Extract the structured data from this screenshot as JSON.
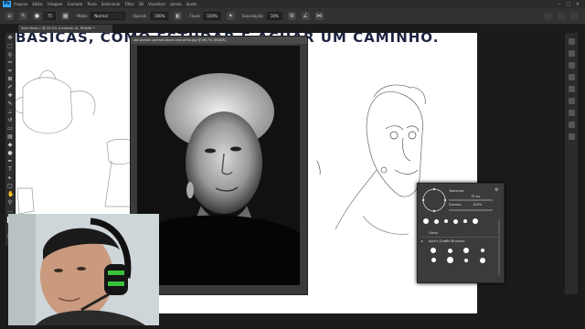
{
  "menubar": {
    "items": [
      "Arquivo",
      "Editar",
      "Imagem",
      "Camada",
      "Texto",
      "Selecionar",
      "Filtro",
      "3D",
      "Visualizar",
      "Janela",
      "Ajuda"
    ],
    "controls": [
      "–",
      "□",
      "✕"
    ]
  },
  "options": {
    "size_value": "75",
    "mode_label": "Modo:",
    "mode_value": "Normal",
    "opacity_label": "Opacid.:",
    "opacity_value": "100%",
    "flow_label": "Fluxo:",
    "flow_value": "100%",
    "smooth_label": "Suavização:",
    "smooth_value": "10%"
  },
  "document": {
    "tab_label": "Sem título-1 @ 33,3% (Camada 14, RGB/8) *",
    "canvas_title": "BÁSICAS, COMO ESTUDAR E ACHAR UM CAMINHO."
  },
  "photo_window": {
    "title": "old-woman-portrait-black-and-white.jpg @ 66,7% (RGB/8)",
    "status": "66,67%"
  },
  "brush_panel": {
    "size_label": "Tamanho:",
    "size_value": "75 px",
    "hardness_label": "Dureza:",
    "hardness_value": "100%",
    "folder_label": "Kyle's Graffiti Brushes",
    "section_label": "Geral"
  },
  "colors": {
    "accent": "#31a8ff",
    "panel": "#323232",
    "canvas": "#ffffff",
    "title_ink": "#1d2440",
    "headset_green": "#38c33a"
  }
}
